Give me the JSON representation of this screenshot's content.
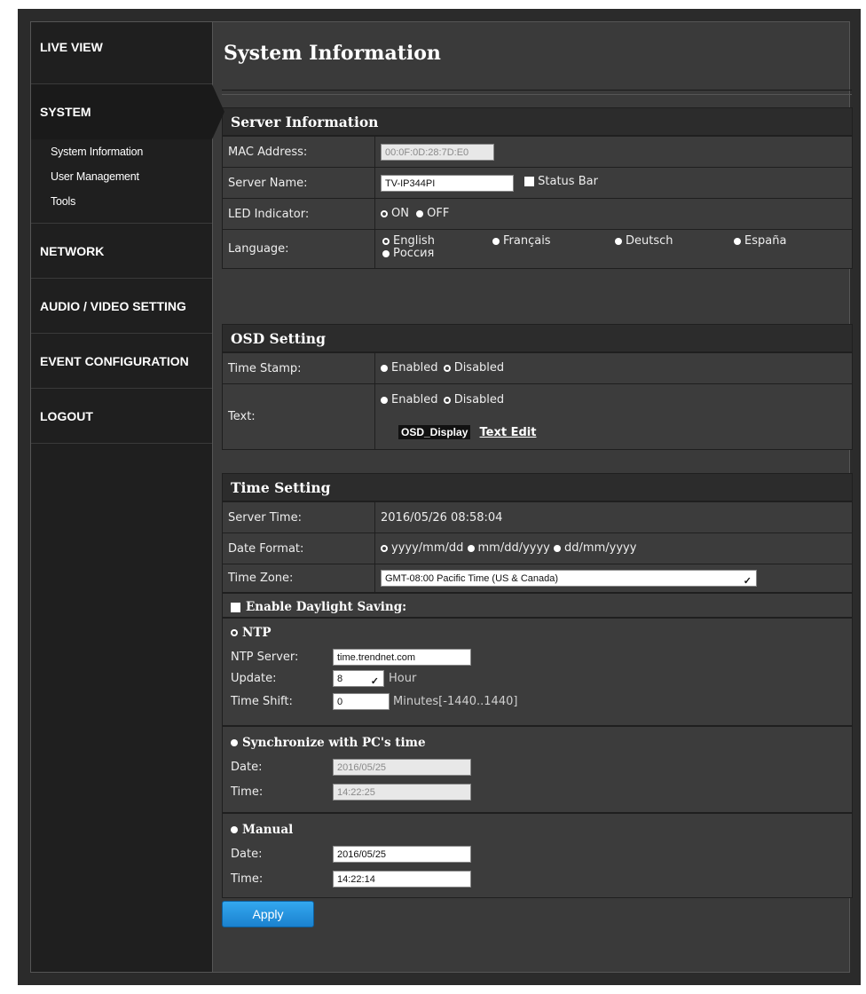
{
  "nav": {
    "live_view": "LIVE VIEW",
    "system": "SYSTEM",
    "system_sub": [
      "System Information",
      "User Management",
      "Tools"
    ],
    "network": "NETWORK",
    "audio_video": "AUDIO / VIDEO SETTING",
    "event": "EVENT CONFIGURATION",
    "logout": "LOGOUT"
  },
  "page": {
    "title": "System Information"
  },
  "server_info": {
    "heading": "Server Information",
    "mac_label": "MAC Address:",
    "mac_value": "00:0F:0D:28:7D:E0",
    "name_label": "Server Name:",
    "name_value": "TV-IP344PI",
    "status_bar": "Status Bar",
    "led_label": "LED Indicator:",
    "led_on": "ON",
    "led_off": "OFF",
    "lang_label": "Language:",
    "languages": [
      "English",
      "Français",
      "Deutsch",
      "España",
      "Россия"
    ]
  },
  "osd": {
    "heading": "OSD Setting",
    "time_stamp_label": "Time Stamp:",
    "text_label": "Text:",
    "enabled": "Enabled",
    "disabled": "Disabled",
    "osd_text": "OSD_Display",
    "text_edit": "Text Edit"
  },
  "time": {
    "heading": "Time Setting",
    "server_time_label": "Server Time:",
    "server_time_value": "2016/05/26 08:58:04",
    "date_format_label": "Date Format:",
    "formats": [
      "yyyy/mm/dd",
      "mm/dd/yyyy",
      "dd/mm/yyyy"
    ],
    "tz_label": "Time Zone:",
    "tz_value": "GMT-08:00 Pacific Time (US & Canada)",
    "dst_label": "Enable Daylight Saving:",
    "ntp_label": "NTP",
    "ntp_server_label": "NTP Server:",
    "ntp_server_value": "time.trendnet.com",
    "update_label": "Update:",
    "update_value": "8",
    "update_unit": "Hour",
    "shift_label": "Time Shift:",
    "shift_value": "0",
    "shift_unit": "Minutes[-1440..1440]",
    "sync_label": "Synchronize with PC's time",
    "sync_date_label": "Date:",
    "sync_date_value": "2016/05/25",
    "sync_time_label": "Time:",
    "sync_time_value": "14:22:25",
    "manual_label": "Manual",
    "manual_date_label": "Date:",
    "manual_date_value": "2016/05/25",
    "manual_time_label": "Time:",
    "manual_time_value": "14:22:14"
  },
  "actions": {
    "apply": "Apply"
  }
}
